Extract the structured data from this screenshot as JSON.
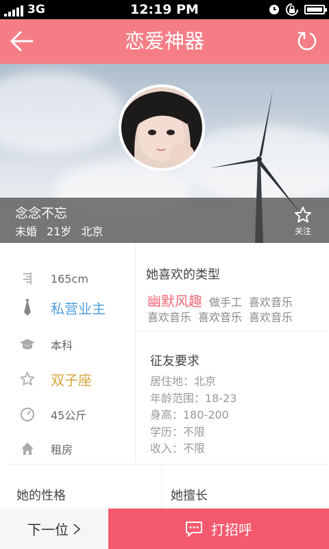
{
  "status_bar": {
    "carrier": "3G",
    "time": "12:19 PM"
  },
  "header": {
    "title": "恋爱神器",
    "back_icon": "arrow-left-icon",
    "refresh_icon": "refresh-icon"
  },
  "profile": {
    "name": "念念不忘",
    "marital": "未婚",
    "age": "21岁",
    "city": "北京",
    "follow_label": "关注"
  },
  "basic_info": [
    {
      "icon": "height-icon",
      "value": "165cm",
      "style": "normal"
    },
    {
      "icon": "tie-icon",
      "value": "私营业主",
      "style": "blue"
    },
    {
      "icon": "graduation-cap-icon",
      "value": "本科",
      "style": "normal"
    },
    {
      "icon": "star-icon",
      "value": "双子座",
      "style": "gold"
    },
    {
      "icon": "scale-icon",
      "value": "45公斤",
      "style": "normal"
    },
    {
      "icon": "house-icon",
      "value": "租房",
      "style": "normal"
    }
  ],
  "likes": {
    "title": "她喜欢的类型",
    "tags": [
      "幽默风趣",
      "做手工",
      "喜欢音乐",
      "喜欢音乐",
      "喜欢音乐",
      "喜欢音乐"
    ]
  },
  "requirements": {
    "title": "征友要求",
    "items": [
      "居住地：北京",
      "年龄范围：18-23",
      "身高：180-200",
      "学历：不限",
      "收入：不限"
    ]
  },
  "sections": {
    "personality": "她的性格",
    "skills": "她擅长"
  },
  "actions": {
    "next": "下一位",
    "greet": "打招呼"
  },
  "colors": {
    "header": "#f57e86",
    "accent": "#f5596d",
    "blue": "#4f9fe0",
    "gold": "#d4a63c"
  }
}
